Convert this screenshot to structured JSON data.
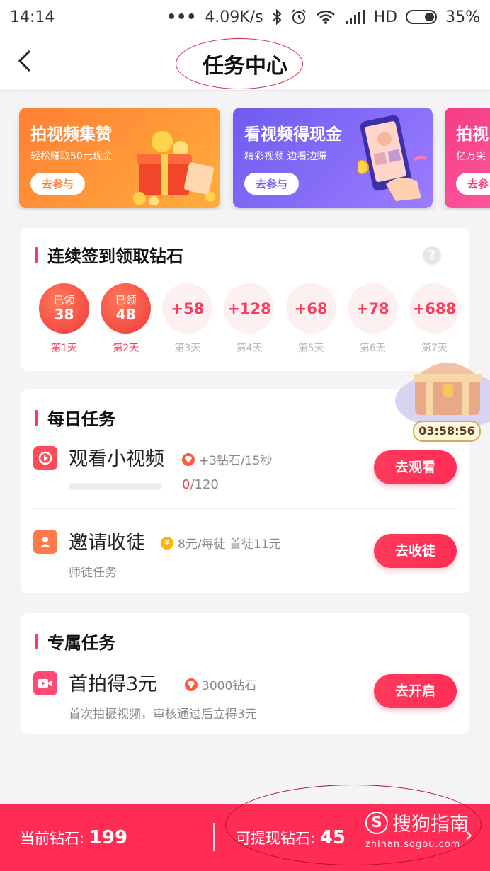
{
  "status_bar": {
    "time": "14:14",
    "dots": "•••",
    "network_speed": "4.09K/s",
    "bluetooth_icon": "bluetooth-icon",
    "alarm_icon": "alarm-icon",
    "wifi_icon": "wifi-icon",
    "signal_icon": "signal-icon",
    "hd": "HD",
    "battery_percent": "35%",
    "battery_level": 0.35
  },
  "header": {
    "back_icon": "back-arrow-icon",
    "title": "任务中心"
  },
  "banners": [
    {
      "title": "拍视频集赞",
      "subtitle": "轻松赚取50元现金",
      "button": "去参与"
    },
    {
      "title": "看视频得现金",
      "subtitle": "精彩视频 边看边赚",
      "button": "去参与"
    },
    {
      "title": "拍视",
      "subtitle": "亿万奖",
      "button": "去参"
    }
  ],
  "signin": {
    "title": "连续签到领取钻石",
    "help_icon": "question-icon",
    "help_glyph": "?",
    "days": [
      {
        "status_label": "已领",
        "value": "38",
        "day_label": "第1天"
      },
      {
        "status_label": "已领",
        "value": "48",
        "day_label": "第2天"
      },
      {
        "value": "+58",
        "day_label": "第3天"
      },
      {
        "value": "+128",
        "day_label": "第4天"
      },
      {
        "value": "+68",
        "day_label": "第5天"
      },
      {
        "value": "+78",
        "day_label": "第6天"
      },
      {
        "value": "+688",
        "day_label": "第7天"
      }
    ]
  },
  "treasure": {
    "icon": "treasure-chest-icon",
    "countdown": "03:58:56"
  },
  "daily_tasks": {
    "title": "每日任务",
    "tasks": [
      {
        "icon": "video-play-icon",
        "name": "观看小视频",
        "reward_icon": "diamond-icon",
        "reward": "+3钻石/15秒",
        "progress_current": "0",
        "progress_total": "/120",
        "progress_fraction": 0,
        "button": "去观看"
      },
      {
        "icon": "user-icon",
        "name": "邀请收徒",
        "reward_icon": "yuan-coin-icon",
        "reward_glyph": "¥",
        "reward": "8元/每徒 首徒11元",
        "desc": "师徒任务",
        "button": "去收徒"
      }
    ]
  },
  "exclusive_tasks": {
    "title": "专属任务",
    "tasks": [
      {
        "icon": "video-camera-icon",
        "name": "首拍得3元",
        "reward_icon": "diamond-icon",
        "reward": "3000钻石",
        "desc": "首次拍摄视频，审核通过后立得3元",
        "button": "去开启"
      }
    ]
  },
  "bottom_bar": {
    "current_label": "当前钻石: ",
    "current_value": "199",
    "withdrawable_label": "可提现钻石: ",
    "withdrawable_value": "45",
    "chevron": "›"
  },
  "watermark": {
    "logo": "S",
    "brand": "搜狗指南",
    "url": "zhinan.sogou.com"
  },
  "colors": {
    "accent": "#ff2d55",
    "annotation": "#d7263d"
  }
}
